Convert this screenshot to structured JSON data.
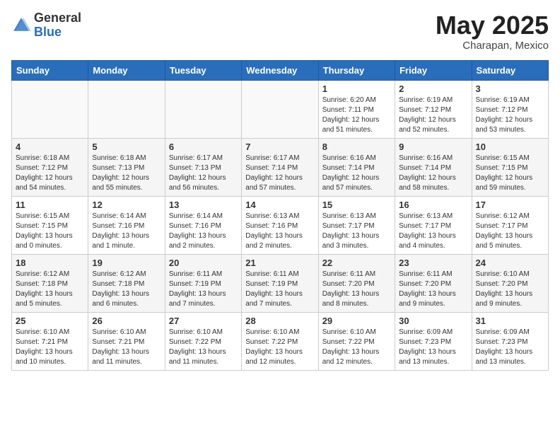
{
  "header": {
    "logo_general": "General",
    "logo_blue": "Blue",
    "month_year": "May 2025",
    "location": "Charapan, Mexico"
  },
  "days_of_week": [
    "Sunday",
    "Monday",
    "Tuesday",
    "Wednesday",
    "Thursday",
    "Friday",
    "Saturday"
  ],
  "weeks": [
    [
      {
        "day": "",
        "info": ""
      },
      {
        "day": "",
        "info": ""
      },
      {
        "day": "",
        "info": ""
      },
      {
        "day": "",
        "info": ""
      },
      {
        "day": "1",
        "info": "Sunrise: 6:20 AM\nSunset: 7:11 PM\nDaylight: 12 hours\nand 51 minutes."
      },
      {
        "day": "2",
        "info": "Sunrise: 6:19 AM\nSunset: 7:12 PM\nDaylight: 12 hours\nand 52 minutes."
      },
      {
        "day": "3",
        "info": "Sunrise: 6:19 AM\nSunset: 7:12 PM\nDaylight: 12 hours\nand 53 minutes."
      }
    ],
    [
      {
        "day": "4",
        "info": "Sunrise: 6:18 AM\nSunset: 7:12 PM\nDaylight: 12 hours\nand 54 minutes."
      },
      {
        "day": "5",
        "info": "Sunrise: 6:18 AM\nSunset: 7:13 PM\nDaylight: 12 hours\nand 55 minutes."
      },
      {
        "day": "6",
        "info": "Sunrise: 6:17 AM\nSunset: 7:13 PM\nDaylight: 12 hours\nand 56 minutes."
      },
      {
        "day": "7",
        "info": "Sunrise: 6:17 AM\nSunset: 7:14 PM\nDaylight: 12 hours\nand 57 minutes."
      },
      {
        "day": "8",
        "info": "Sunrise: 6:16 AM\nSunset: 7:14 PM\nDaylight: 12 hours\nand 57 minutes."
      },
      {
        "day": "9",
        "info": "Sunrise: 6:16 AM\nSunset: 7:14 PM\nDaylight: 12 hours\nand 58 minutes."
      },
      {
        "day": "10",
        "info": "Sunrise: 6:15 AM\nSunset: 7:15 PM\nDaylight: 12 hours\nand 59 minutes."
      }
    ],
    [
      {
        "day": "11",
        "info": "Sunrise: 6:15 AM\nSunset: 7:15 PM\nDaylight: 13 hours\nand 0 minutes."
      },
      {
        "day": "12",
        "info": "Sunrise: 6:14 AM\nSunset: 7:16 PM\nDaylight: 13 hours\nand 1 minute."
      },
      {
        "day": "13",
        "info": "Sunrise: 6:14 AM\nSunset: 7:16 PM\nDaylight: 13 hours\nand 2 minutes."
      },
      {
        "day": "14",
        "info": "Sunrise: 6:13 AM\nSunset: 7:16 PM\nDaylight: 13 hours\nand 2 minutes."
      },
      {
        "day": "15",
        "info": "Sunrise: 6:13 AM\nSunset: 7:17 PM\nDaylight: 13 hours\nand 3 minutes."
      },
      {
        "day": "16",
        "info": "Sunrise: 6:13 AM\nSunset: 7:17 PM\nDaylight: 13 hours\nand 4 minutes."
      },
      {
        "day": "17",
        "info": "Sunrise: 6:12 AM\nSunset: 7:17 PM\nDaylight: 13 hours\nand 5 minutes."
      }
    ],
    [
      {
        "day": "18",
        "info": "Sunrise: 6:12 AM\nSunset: 7:18 PM\nDaylight: 13 hours\nand 5 minutes."
      },
      {
        "day": "19",
        "info": "Sunrise: 6:12 AM\nSunset: 7:18 PM\nDaylight: 13 hours\nand 6 minutes."
      },
      {
        "day": "20",
        "info": "Sunrise: 6:11 AM\nSunset: 7:19 PM\nDaylight: 13 hours\nand 7 minutes."
      },
      {
        "day": "21",
        "info": "Sunrise: 6:11 AM\nSunset: 7:19 PM\nDaylight: 13 hours\nand 7 minutes."
      },
      {
        "day": "22",
        "info": "Sunrise: 6:11 AM\nSunset: 7:20 PM\nDaylight: 13 hours\nand 8 minutes."
      },
      {
        "day": "23",
        "info": "Sunrise: 6:11 AM\nSunset: 7:20 PM\nDaylight: 13 hours\nand 9 minutes."
      },
      {
        "day": "24",
        "info": "Sunrise: 6:10 AM\nSunset: 7:20 PM\nDaylight: 13 hours\nand 9 minutes."
      }
    ],
    [
      {
        "day": "25",
        "info": "Sunrise: 6:10 AM\nSunset: 7:21 PM\nDaylight: 13 hours\nand 10 minutes."
      },
      {
        "day": "26",
        "info": "Sunrise: 6:10 AM\nSunset: 7:21 PM\nDaylight: 13 hours\nand 11 minutes."
      },
      {
        "day": "27",
        "info": "Sunrise: 6:10 AM\nSunset: 7:22 PM\nDaylight: 13 hours\nand 11 minutes."
      },
      {
        "day": "28",
        "info": "Sunrise: 6:10 AM\nSunset: 7:22 PM\nDaylight: 13 hours\nand 12 minutes."
      },
      {
        "day": "29",
        "info": "Sunrise: 6:10 AM\nSunset: 7:22 PM\nDaylight: 13 hours\nand 12 minutes."
      },
      {
        "day": "30",
        "info": "Sunrise: 6:09 AM\nSunset: 7:23 PM\nDaylight: 13 hours\nand 13 minutes."
      },
      {
        "day": "31",
        "info": "Sunrise: 6:09 AM\nSunset: 7:23 PM\nDaylight: 13 hours\nand 13 minutes."
      }
    ]
  ]
}
